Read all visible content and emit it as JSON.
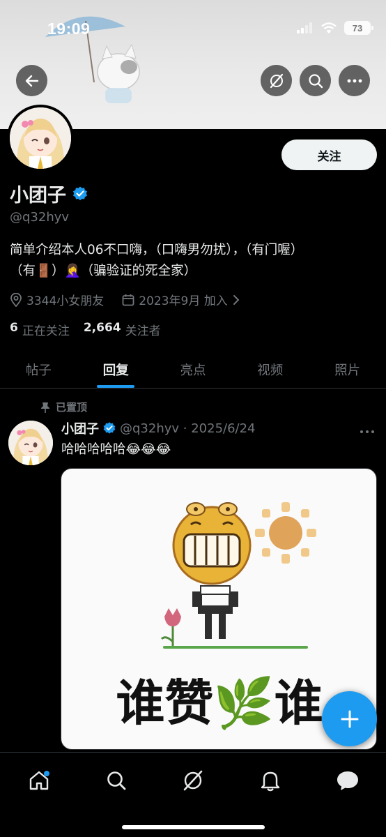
{
  "status_bar": {
    "time": "19:09",
    "battery": "73"
  },
  "profile": {
    "follow_label": "关注",
    "display_name": "小团子",
    "handle": "@q32hyv",
    "bio_line1": "简单介绍本人06不口嗨，（口嗨男勿扰），（有门喔）",
    "bio_line2": "（有🚪）🤦‍♀️（骗验证的死全家）",
    "location": "3344小女朋友",
    "joined": "2023年9月 加入",
    "following_count": "6",
    "following_label": "正在关注",
    "followers_count": "2,664",
    "followers_label": "关注者"
  },
  "tabs": [
    {
      "label": "帖子"
    },
    {
      "label": "回复"
    },
    {
      "label": "亮点"
    },
    {
      "label": "视频"
    },
    {
      "label": "照片"
    }
  ],
  "post": {
    "pinned_label": "已置顶",
    "name": "小团子",
    "handle_date": "@q32hyv · 2025/6/24",
    "text": "哈哈哈哈哈😂😂😂",
    "meme_caption_left": "谁赞",
    "meme_caption_leaf": "🌿",
    "meme_caption_right": "谁"
  },
  "icons": {
    "back": "back-arrow-icon",
    "grok": "grok-icon",
    "search": "search-icon",
    "more": "more-icon",
    "verified": "verified-badge-icon",
    "location": "location-pin-icon",
    "calendar": "calendar-icon",
    "pin": "pin-icon",
    "compose": "plus-icon",
    "nav": [
      "home-icon",
      "search-icon",
      "grok-icon",
      "bell-icon",
      "chat-icon"
    ]
  },
  "colors": {
    "accent": "#1d9bf0",
    "background": "#000000",
    "secondary_text": "#71767b"
  }
}
